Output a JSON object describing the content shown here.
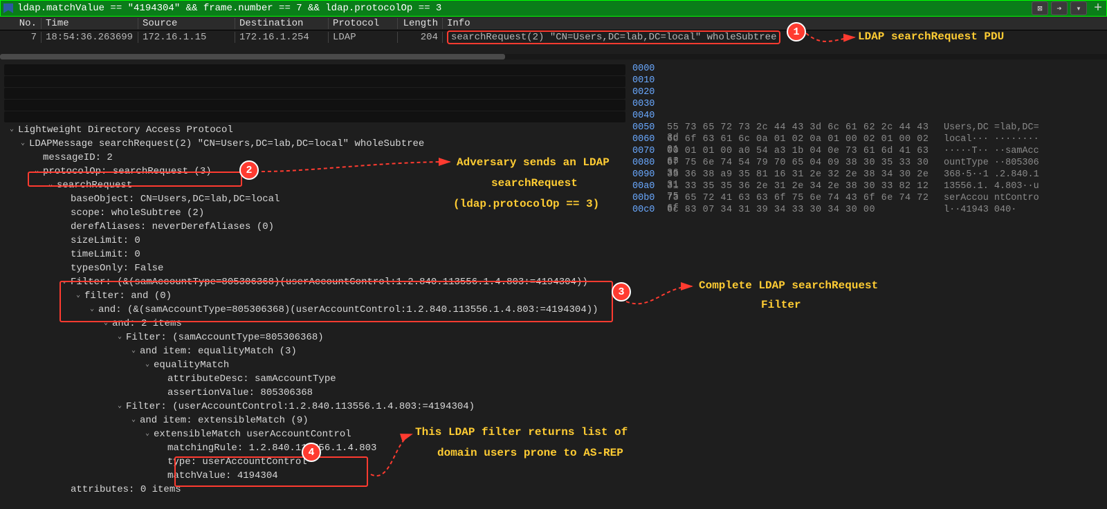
{
  "filter": "ldap.matchValue == \"4194304\" && frame.number == 7 && ldap.protocolOp == 3",
  "toolbar": {
    "clear": "⊠",
    "next": "➔",
    "menu": "▾",
    "plus": "+"
  },
  "headers": {
    "no": "No.",
    "time": "Time",
    "source": "Source",
    "destination": "Destination",
    "protocol": "Protocol",
    "length": "Length",
    "info": "Info"
  },
  "packet": {
    "no": "7",
    "time": "18:54:36.263699",
    "source": "172.16.1.15",
    "destination": "172.16.1.254",
    "protocol": "LDAP",
    "length": "204",
    "info": "searchRequest(2) \"CN=Users,DC=lab,DC=local\" wholeSubtree"
  },
  "tree": {
    "r0": "Lightweight Directory Access Protocol",
    "r1": "LDAPMessage searchRequest(2) \"CN=Users,DC=lab,DC=local\" wholeSubtree",
    "r2": "messageID: 2",
    "r3": "protocolOp: searchRequest (3)",
    "r4": "searchRequest",
    "r5": "baseObject: CN=Users,DC=lab,DC=local",
    "r6": "scope: wholeSubtree (2)",
    "r7": "derefAliases: neverDerefAliases (0)",
    "r8": "sizeLimit: 0",
    "r9": "timeLimit: 0",
    "r10": "typesOnly: False",
    "r11": "Filter: (&(samAccountType=805306368)(userAccountControl:1.2.840.113556.1.4.803:=4194304))",
    "r12": "filter: and (0)",
    "r13": "and: (&(samAccountType=805306368)(userAccountControl:1.2.840.113556.1.4.803:=4194304))",
    "r14": "and: 2 items",
    "r15": "Filter: (samAccountType=805306368)",
    "r16": "and item: equalityMatch (3)",
    "r17": "equalityMatch",
    "r18": "attributeDesc: samAccountType",
    "r19": "assertionValue: 805306368",
    "r20": "Filter: (userAccountControl:1.2.840.113556.1.4.803:=4194304)",
    "r21": "and item: extensibleMatch (9)",
    "r22": "extensibleMatch userAccountControl",
    "r23": "matchingRule: 1.2.840.113556.1.4.803",
    "r24": "type: userAccountControl",
    "r25": "matchValue: 4194304",
    "r26": "attributes: 0 items"
  },
  "hex": [
    {
      "off": "0000",
      "hex": "",
      "asc": ""
    },
    {
      "off": "0010",
      "hex": "",
      "asc": ""
    },
    {
      "off": "0020",
      "hex": "",
      "asc": ""
    },
    {
      "off": "0030",
      "hex": "",
      "asc": ""
    },
    {
      "off": "0040",
      "hex": "",
      "asc": ""
    },
    {
      "off": "0050",
      "hex": "55 73 65 72 73 2c 44 43  3d 6c 61 62 2c 44 43 3d",
      "asc": "Users,DC =lab,DC="
    },
    {
      "off": "0060",
      "hex": "6c 6f 63 61 6c 0a 01 02  0a 01 00 02 01 00 02 01",
      "asc": "local··· ········"
    },
    {
      "off": "0070",
      "hex": "00 01 01 00 a0 54 a3 1b  04 0e 73 61 6d 41 63 63",
      "asc": "·····T·· ··samAcc"
    },
    {
      "off": "0080",
      "hex": "6f 75 6e 74 54 79 70 65  04 09 38 30 35 33 30 36",
      "asc": "ountType ··805306"
    },
    {
      "off": "0090",
      "hex": "33 36 38 a9 35 81 16 31  2e 32 2e 38 34 30 2e 31",
      "asc": "368·5··1 .2.840.1"
    },
    {
      "off": "00a0",
      "hex": "31 33 35 35 36 2e 31 2e  34 2e 38 30 33 82 12 75",
      "asc": "13556.1. 4.803··u"
    },
    {
      "off": "00b0",
      "hex": "73 65 72 41 63 63 6f 75  6e 74 43 6f 6e 74 72 6f",
      "asc": "serAccou ntContro"
    },
    {
      "off": "00c0",
      "hex": "6c 83 07 34 31 39 34 33  30 34 30 00",
      "asc": "l··41943 040·"
    }
  ],
  "annotations": {
    "a1": "LDAP searchRequest PDU",
    "a2a": "Adversary sends an LDAP",
    "a2b": "searchRequest",
    "a2c": "(ldap.protocolOp == 3)",
    "a3a": "Complete LDAP searchRequest",
    "a3b": "Filter",
    "a4a": "This LDAP filter returns list of",
    "a4b": "domain users prone to AS-REP"
  },
  "badges": {
    "b1": "1",
    "b2": "2",
    "b3": "3",
    "b4": "4"
  }
}
